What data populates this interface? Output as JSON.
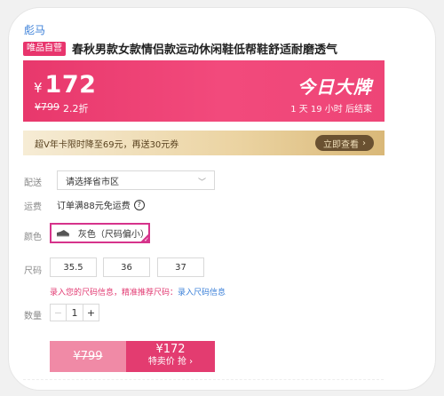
{
  "product": {
    "brand": "彪马",
    "badge": "唯品自营",
    "title": "春秋男款女款情侣款运动休闲鞋低帮鞋舒适耐磨透气"
  },
  "price": {
    "currency": "¥",
    "current": "172",
    "original": "¥799",
    "discount": "2.2折",
    "deal_title": "今日大牌",
    "countdown": "1 天 19 小时 后结束"
  },
  "coupon": {
    "text": "超V年卡限时降至69元，再送30元券",
    "button": "立即查看"
  },
  "delivery": {
    "label": "配送",
    "placeholder": "请选择省市区"
  },
  "shipping": {
    "label": "运费",
    "text": "订单满88元免运费"
  },
  "color": {
    "label": "颜色",
    "option": "灰色（尺码偏小）"
  },
  "size": {
    "label": "尺码",
    "options": [
      "35.5",
      "36",
      "37"
    ],
    "hint": "录入您的尺码信息，精准推荐尺码：",
    "hint_link": "录入尺码信息"
  },
  "quantity": {
    "label": "数量",
    "minus": "−",
    "value": "1",
    "plus": "+"
  },
  "buy": {
    "original": "¥799",
    "price": "¥172",
    "action": "特卖价 抢 ›"
  },
  "colors": {
    "accent": "#e8386c",
    "gold": "#6a5131",
    "link": "#3a7fd8"
  }
}
